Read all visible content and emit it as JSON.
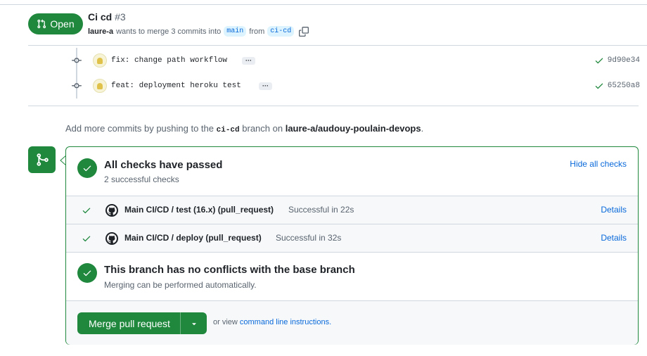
{
  "header": {
    "state_label": "Open",
    "title": "Ci cd",
    "number": "#3",
    "author": "laure-a",
    "meta_text": "wants to merge 3 commits into",
    "base_branch": "main",
    "from_text": "from",
    "head_branch": "ci-cd"
  },
  "commits": [
    {
      "message": "fix: change path workflow",
      "ellipsis": "···",
      "sha": "9d90e34"
    },
    {
      "message": "feat: deployment heroku test",
      "ellipsis": "···",
      "sha": "65250a8"
    }
  ],
  "push_hint": {
    "prefix": "Add more commits by pushing to the",
    "branch": "ci-cd",
    "middle": "branch on",
    "repo": "laure-a/audouy-poulain-devops",
    "suffix": "."
  },
  "checks": {
    "title": "All checks have passed",
    "subtitle": "2 successful checks",
    "hide_label": "Hide all checks",
    "rows": [
      {
        "name": "Main CI/CD / test (16.x) (pull_request)",
        "status": "Successful in 22s",
        "details": "Details"
      },
      {
        "name": "Main CI/CD / deploy (pull_request)",
        "status": "Successful in 32s",
        "details": "Details"
      }
    ]
  },
  "conflicts": {
    "title": "This branch has no conflicts with the base branch",
    "subtitle": "Merging can be performed automatically."
  },
  "merge": {
    "button_label": "Merge pull request",
    "or_view": "or view",
    "cli_link": "command line instructions."
  },
  "colors": {
    "success": "#1f883d",
    "link": "#0969da",
    "muted": "#59636e"
  }
}
